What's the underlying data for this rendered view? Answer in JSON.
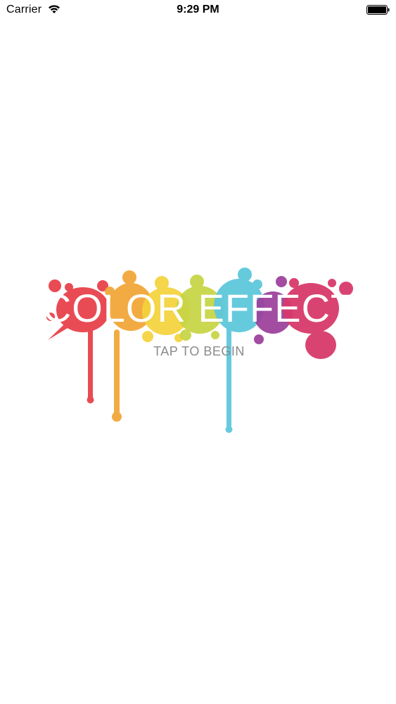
{
  "status_bar": {
    "carrier": "Carrier",
    "time": "9:29 PM",
    "wifi_icon": "wifi-icon",
    "battery_icon": "battery-icon"
  },
  "splash": {
    "title": "COLOR EFFECT",
    "prompt": "TAP TO BEGIN",
    "colors": {
      "red": "#e8424b",
      "orange": "#f2a535",
      "yellow": "#f5d23c",
      "lime": "#c7d444",
      "cyan": "#5ec8dc",
      "purple": "#9b3f9c",
      "magenta": "#d8396b",
      "title": "#ffffff",
      "prompt": "#8a8a8a"
    }
  }
}
